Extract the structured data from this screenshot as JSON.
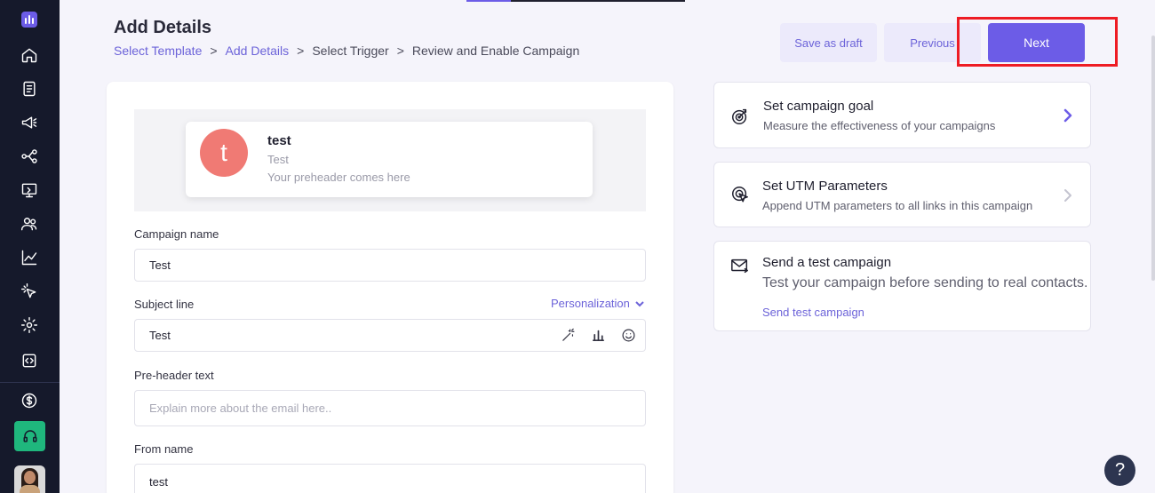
{
  "sidebar": {
    "icons": [
      "home-icon",
      "document-icon",
      "megaphone-icon",
      "workflow-icon",
      "monitor-icon",
      "users-icon",
      "chart-icon",
      "cursor-click-icon",
      "gear-icon",
      "code-icon",
      "dollar-icon",
      "headset-icon"
    ]
  },
  "header": {
    "title": "Add Details",
    "breadcrumb": [
      {
        "label": "Select Template",
        "link": true
      },
      {
        "label": "Add Details",
        "link": true
      },
      {
        "label": "Select Trigger",
        "link": false
      },
      {
        "label": "Review and Enable Campaign",
        "link": false
      }
    ],
    "separator": ">",
    "save_draft_label": "Save as draft",
    "previous_label": "Previous",
    "next_label": "Next"
  },
  "preview": {
    "avatar_letter": "t",
    "sender_name": "test",
    "subject": "Test",
    "preheader": "Your preheader comes here"
  },
  "form": {
    "campaign_name_label": "Campaign name",
    "campaign_name_value": "Test",
    "subject_label": "Subject line",
    "personalization_label": "Personalization",
    "subject_value": "Test",
    "preheader_label": "Pre-header text",
    "preheader_placeholder": "Explain more about the email here..",
    "from_name_label": "From name",
    "from_name_value": "test"
  },
  "side_cards": {
    "goal": {
      "title": "Set campaign goal",
      "desc": "Measure the effectiveness of your campaigns"
    },
    "utm": {
      "title": "Set UTM Parameters",
      "desc": "Append UTM parameters to all links in this campaign"
    },
    "test": {
      "title": "Send a test campaign",
      "desc": "Test your campaign before sending to real contacts.",
      "link": "Send test campaign"
    }
  },
  "help_label": "?",
  "colors": {
    "accent": "#6c5ce7",
    "sidebar": "#15192b",
    "highlight": "#ee1c24",
    "support": "#1fb77d"
  }
}
